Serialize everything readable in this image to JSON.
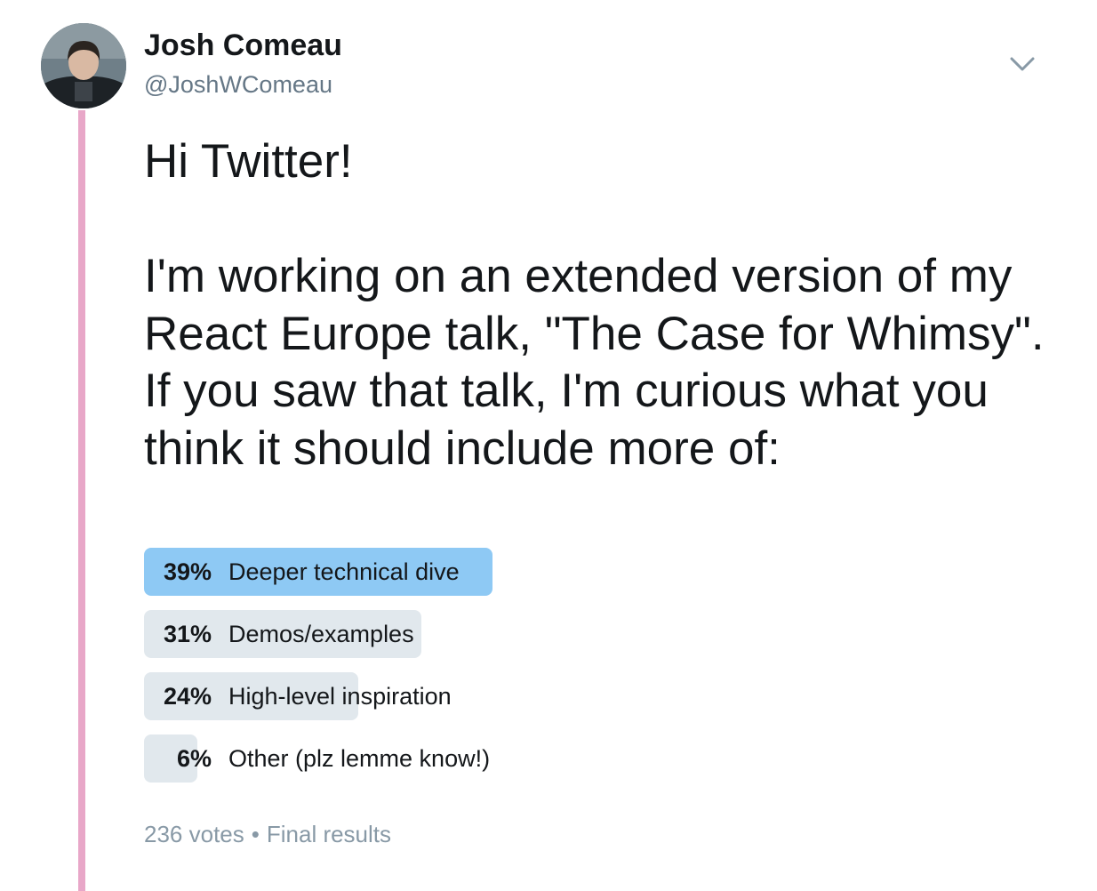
{
  "author": {
    "name": "Josh Comeau",
    "handle": "@JoshWComeau"
  },
  "tweet": {
    "text": "Hi Twitter!\n\nI'm working on an extended version of my React Europe talk, \"The Case for Whimsy\". If you saw that talk, I'm curious what you think it should include more of:"
  },
  "poll": {
    "options": [
      {
        "percent_label": "39%",
        "percent": 39,
        "label": "Deeper technical dive",
        "winner": true
      },
      {
        "percent_label": "31%",
        "percent": 31,
        "label": "Demos/examples",
        "winner": false
      },
      {
        "percent_label": "24%",
        "percent": 24,
        "label": "High-level inspiration",
        "winner": false
      },
      {
        "percent_label": "6%",
        "percent": 6,
        "label": "Other (plz lemme know!)",
        "winner": false
      }
    ],
    "votes": "236 votes",
    "separator": "•",
    "status": "Final results"
  },
  "icons": {
    "menu": "chevron-down-icon",
    "thread": "thread-connector-line"
  },
  "colors": {
    "winner_bar": "#8ec9f4",
    "other_bar": "#e1e8ed",
    "thread_line": "#e8a7c8",
    "secondary_text": "#657786",
    "meta_text": "#8899a6"
  }
}
